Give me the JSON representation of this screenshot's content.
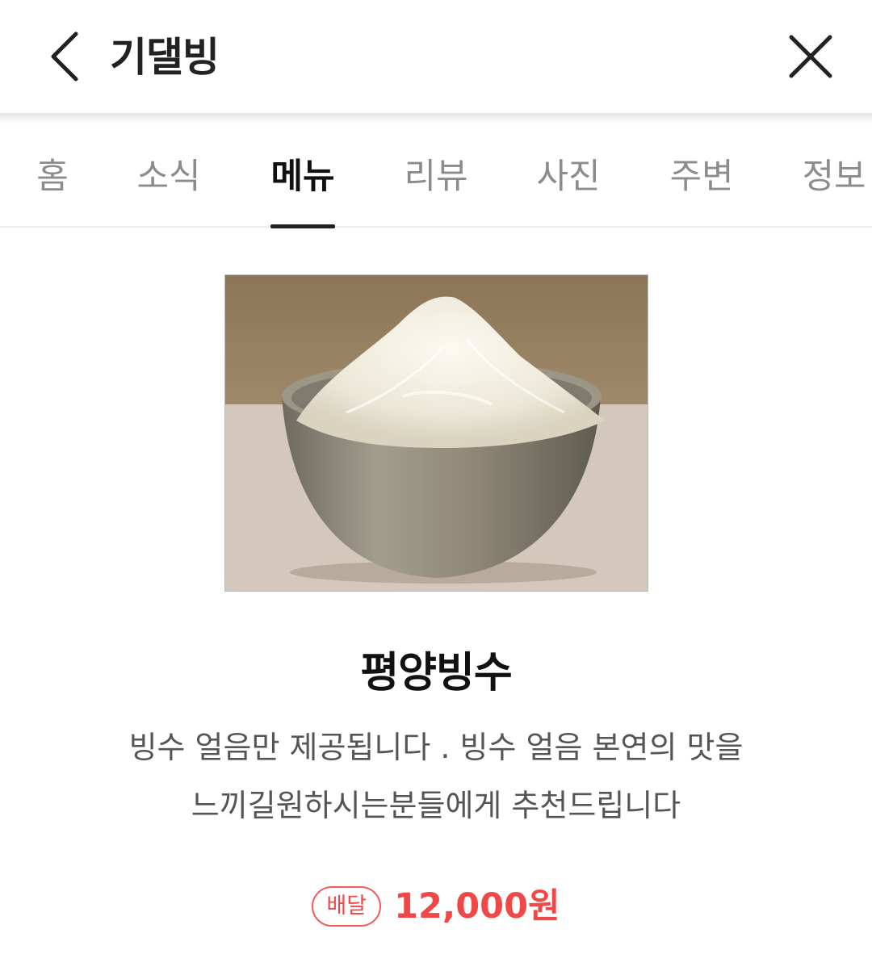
{
  "header": {
    "title": "기댈빙",
    "back_icon": "back-chevron-icon",
    "close_icon": "close-icon"
  },
  "tabs": [
    {
      "label": "홈",
      "active": false
    },
    {
      "label": "소식",
      "active": false
    },
    {
      "label": "메뉴",
      "active": true
    },
    {
      "label": "리뷰",
      "active": false
    },
    {
      "label": "사진",
      "active": false
    },
    {
      "label": "주변",
      "active": false
    },
    {
      "label": "정보",
      "active": false
    }
  ],
  "menu_item": {
    "name": "평양빙수",
    "description_line1": "빙수 얼음만 제공됩니다 . 빙수 얼음 본연의 맛을",
    "description_line2": "느끼길원하시는분들에게 추천드립니다",
    "badge": "배달",
    "price": "12,000원"
  },
  "colors": {
    "accent": "#f04848",
    "active_tab": "#111111",
    "inactive_tab": "#8c8c8c"
  }
}
